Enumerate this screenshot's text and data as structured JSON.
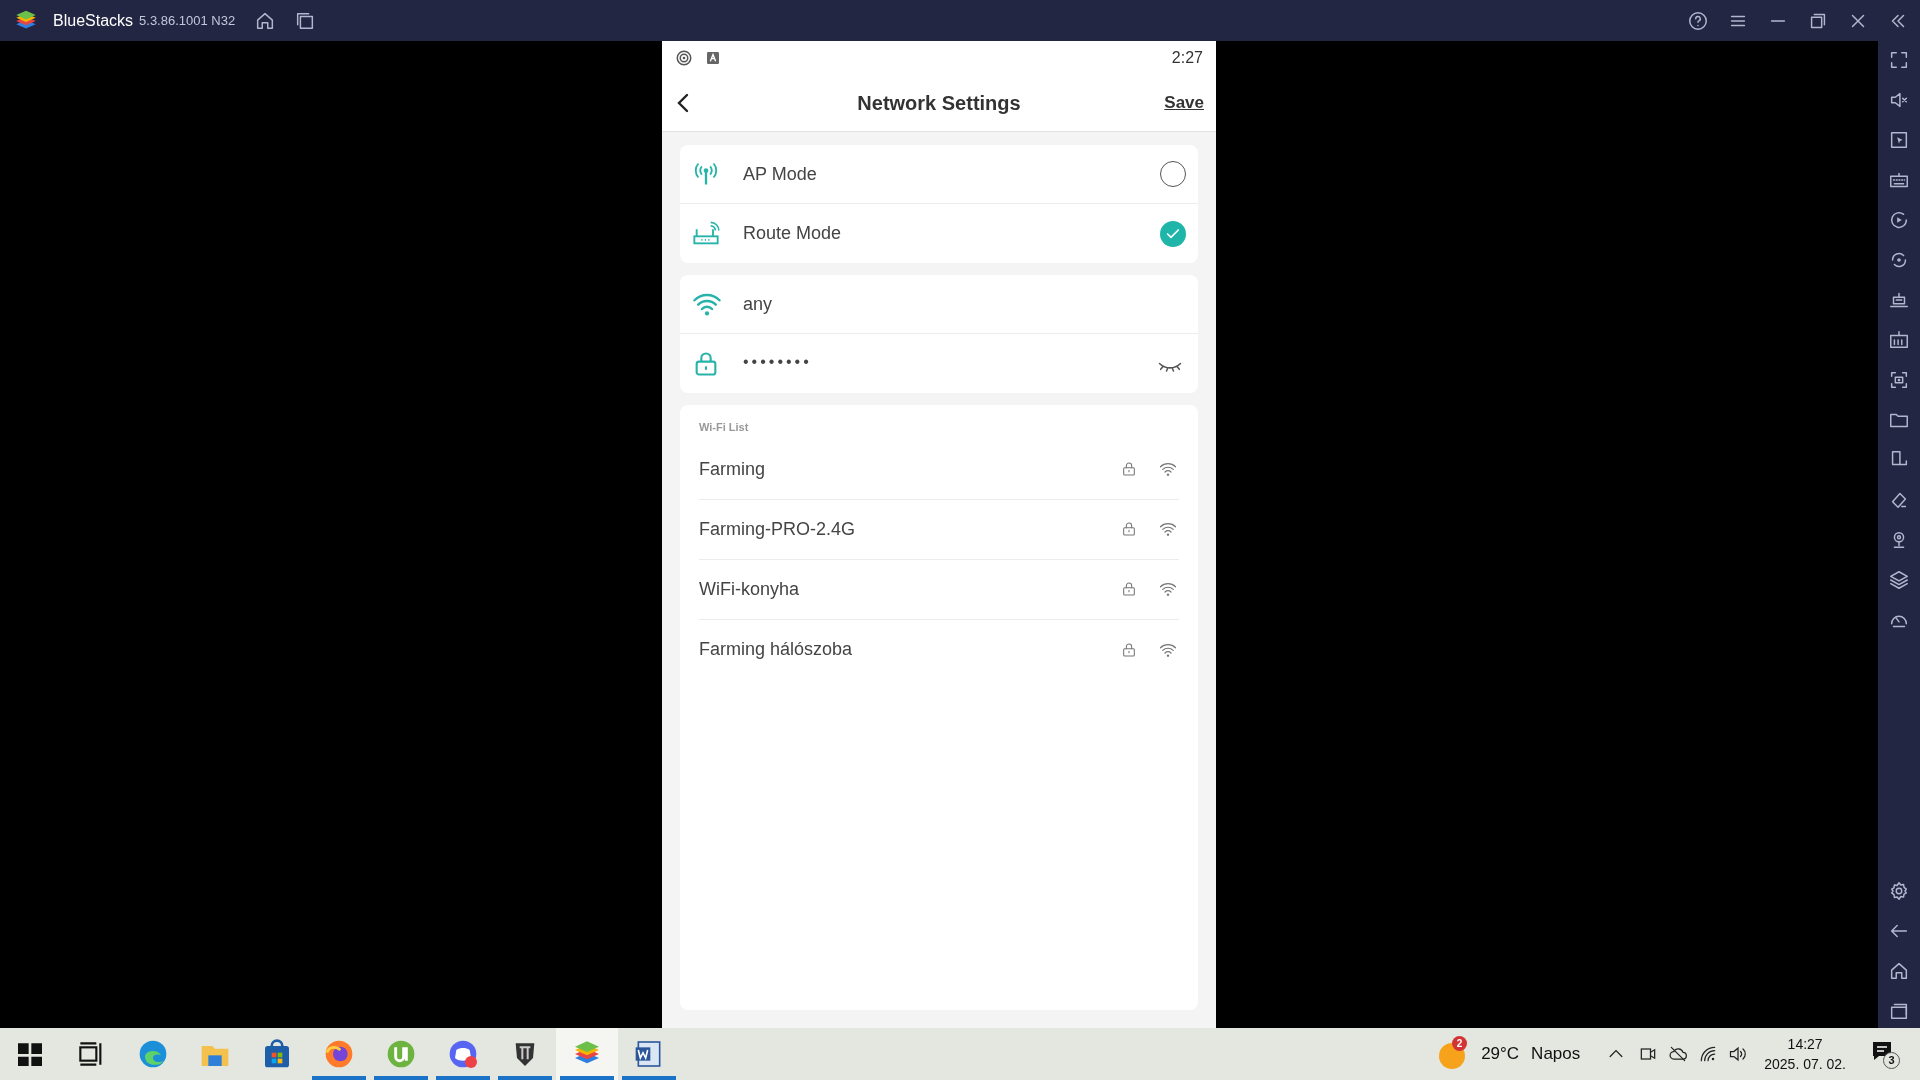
{
  "window": {
    "title": "BlueStacks",
    "version": "5.3.86.1001 N32"
  },
  "phone": {
    "status_bar": {
      "time": "2:27"
    },
    "header": {
      "title": "Network Settings",
      "action": "Save"
    },
    "modes": [
      {
        "kind": "antenna",
        "label": "AP Mode",
        "selected": false
      },
      {
        "kind": "router",
        "label": "Route Mode",
        "selected": true
      }
    ],
    "network": {
      "ssid": "any",
      "password": "••••••••",
      "password_visible": false
    },
    "wifi_list": {
      "heading": "Wi-Fi List",
      "networks": [
        {
          "name": "Farming",
          "locked": true
        },
        {
          "name": "Farming-PRO-2.4G",
          "locked": true
        },
        {
          "name": "WiFi-konyha",
          "locked": true
        },
        {
          "name": "Farming hálószoba",
          "locked": true
        }
      ]
    }
  },
  "taskbar": {
    "apps": [
      {
        "kind": "start",
        "running": false,
        "selected": false
      },
      {
        "kind": "taskview",
        "running": false,
        "selected": false
      },
      {
        "kind": "edge",
        "running": false,
        "selected": false
      },
      {
        "kind": "explorer",
        "running": false,
        "selected": false
      },
      {
        "kind": "store",
        "running": false,
        "selected": false
      },
      {
        "kind": "firefox",
        "running": true,
        "selected": false
      },
      {
        "kind": "utorrent",
        "running": true,
        "selected": false
      },
      {
        "kind": "discord",
        "running": true,
        "selected": false
      },
      {
        "kind": "tank",
        "running": true,
        "selected": false
      },
      {
        "kind": "bluestacks",
        "running": true,
        "selected": true
      },
      {
        "kind": "word",
        "running": true,
        "selected": false
      }
    ],
    "weather": {
      "badge": "2",
      "temperature": "29°C",
      "condition": "Napos"
    },
    "clock": {
      "time": "14:27",
      "date": "2025. 07. 02."
    },
    "notifications": "3"
  }
}
